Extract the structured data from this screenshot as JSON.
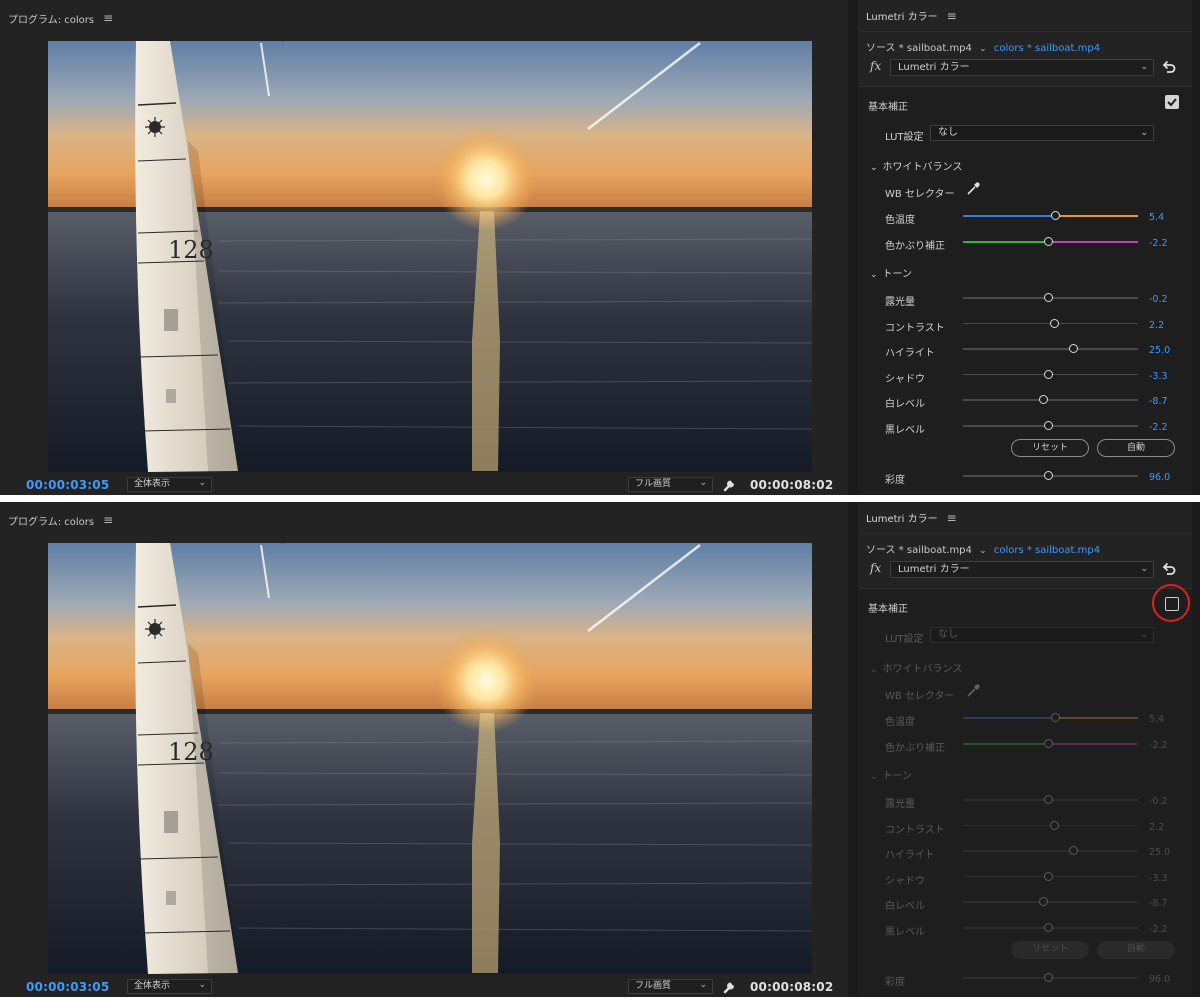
{
  "program": {
    "title": "プログラム: colors",
    "timecode_current": "00:00:03:05",
    "zoom_select": "全体表示",
    "quality_select": "フル画質",
    "timecode_duration": "00:00:08:02",
    "sail_numbers": [
      "128",
      "128"
    ]
  },
  "lumetri": {
    "title": "Lumetri カラー",
    "source": "ソース * sailboat.mp4",
    "target": "colors * sailboat.mp4",
    "fx_label": "fx",
    "effect": "Lumetri カラー",
    "basic_correction": {
      "title": "基本補正",
      "lut_label": "LUT設定",
      "lut_value": "なし",
      "white_balance": {
        "title": "ホワイトバランス",
        "wb_selector": "WB セレクター",
        "controls": [
          {
            "label": "色温度",
            "value": "5.4",
            "fraction": 0.53,
            "colors": [
              "#3a7ad8",
              "#e59a2f"
            ]
          },
          {
            "label": "色かぶり補正",
            "value": "-2.2",
            "fraction": 0.49,
            "colors": [
              "#2fb640",
              "#c43fc0"
            ]
          }
        ]
      },
      "tone": {
        "title": "トーン",
        "controls": [
          {
            "label": "露光量",
            "value": "-0.2",
            "fraction": 0.49
          },
          {
            "label": "コントラスト",
            "value": "2.2",
            "fraction": 0.52
          },
          {
            "label": "ハイライト",
            "value": "25.0",
            "fraction": 0.63
          },
          {
            "label": "シャドウ",
            "value": "-3.3",
            "fraction": 0.49
          },
          {
            "label": "白レベル",
            "value": "-8.7",
            "fraction": 0.46
          },
          {
            "label": "黒レベル",
            "value": "-2.2",
            "fraction": 0.49
          }
        ],
        "reset": "リセット",
        "auto": "自動"
      },
      "saturation": {
        "label": "彩度",
        "value": "96.0",
        "fraction": 0.49
      }
    }
  },
  "screens": [
    {
      "basic_correction_enabled": true,
      "highlighted": false
    },
    {
      "basic_correction_enabled": false,
      "highlighted": true
    }
  ],
  "colors": {
    "timecode_blue": "#3e9aff",
    "value_blue": "#3e9aff",
    "highlight_red": "#e02020"
  }
}
